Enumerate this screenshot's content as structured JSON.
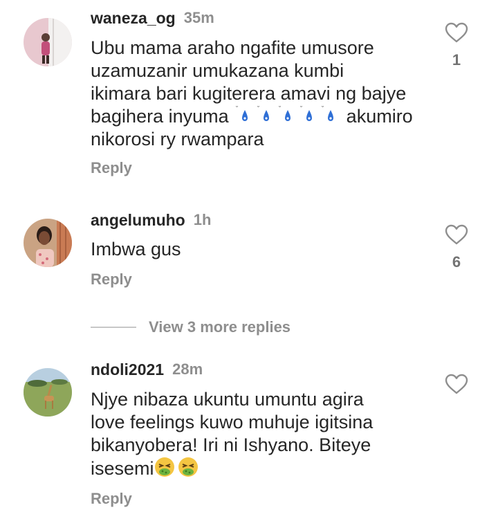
{
  "comments": [
    {
      "username": "waneza_og",
      "time": "35m",
      "text_lines": [
        "Ubu mama araho ngafite umusore",
        "uzamuzanir umukazana kumbi",
        "ikimara bari kugiterera amavi ng bajye",
        "bagihera inyuma",
        "akumiro",
        "nikorosi ry rwampara"
      ],
      "emoji_icon": "sweat-droplets-emoji",
      "emoji_count": 5,
      "reply_label": "Reply",
      "like_icon": "heart-outline-icon",
      "like_count": "1"
    },
    {
      "username": "angelumuho",
      "time": "1h",
      "text_lines": [
        "Imbwa gus"
      ],
      "reply_label": "Reply",
      "like_icon": "heart-outline-icon",
      "like_count": "6"
    },
    {
      "username": "ndoli2021",
      "time": "28m",
      "text_lines": [
        "Njye nibaza ukuntu umuntu agira",
        "love feelings kuwo muhuje igitsina",
        "bikanyobera! Iri ni Ishyano. Biteye",
        "isesemi"
      ],
      "emoji_icon": "nauseated-face-emoji",
      "emoji_count": 2,
      "reply_label": "Reply",
      "like_icon": "heart-outline-icon",
      "like_count": ""
    }
  ],
  "view_more_replies": "View 3 more replies",
  "colors": {
    "text": "#262626",
    "secondary": "#8e8e8e",
    "divider": "#c7c7c7",
    "background": "#ffffff"
  }
}
